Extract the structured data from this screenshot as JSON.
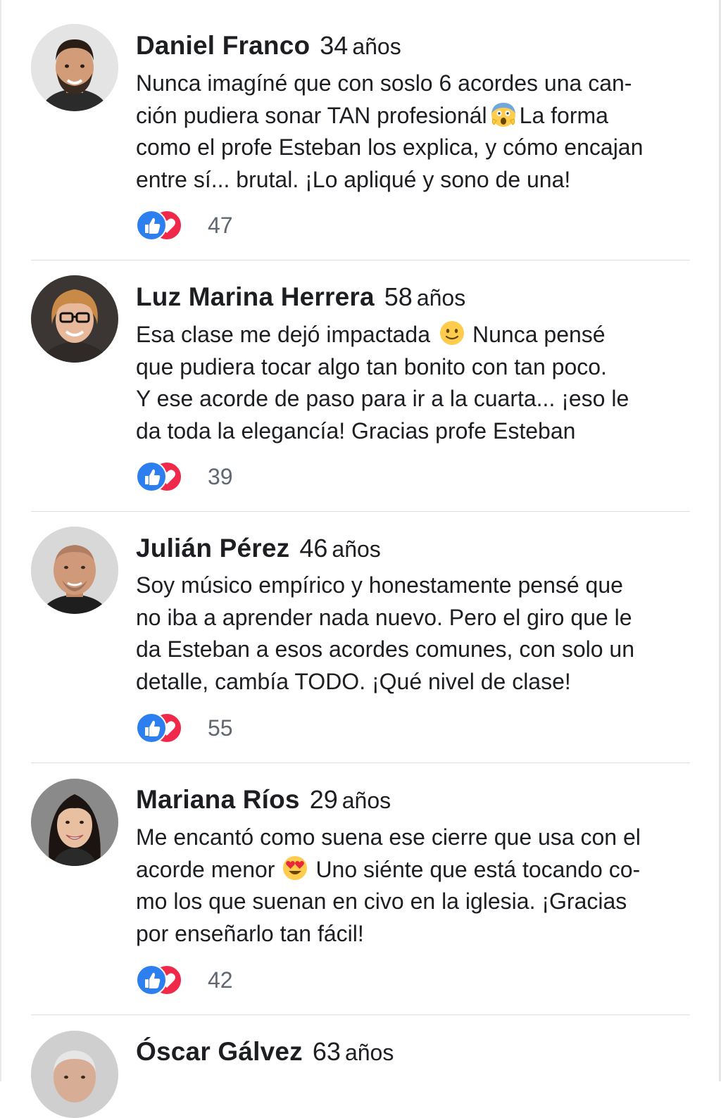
{
  "comments": [
    {
      "name": "Daniel Franco",
      "age": "34",
      "age_unit": "años",
      "lines": [
        "Nunca imagíné que con soslo 6 acordes una can-",
        "ción pudiera sonar TAN profesionál",
        "La forma",
        "como el profe Esteban los explica, y cómo encajan",
        "entre sí... brutal. ¡Lo apliqué y sono de una!"
      ],
      "emoji": "scream-emoji",
      "reactions": "47"
    },
    {
      "name": "Luz Marina Herrera",
      "age": "58",
      "age_unit": "años",
      "lines": [
        "Esa clase me dejó impactada",
        "Nunca pensé",
        "que pudiera tocar algo tan bonito con tan poco.",
        "Y ese acorde de paso para ir a la cuarta...  ¡eso le",
        "da toda la elegancía! Gracias profe Esteban"
      ],
      "emoji": "smile-emoji",
      "reactions": "39"
    },
    {
      "name": "Julián Pérez",
      "age": "46",
      "age_unit": "años",
      "lines": [
        "Soy músico empírico y honestamente pensé que",
        "no iba a aprender nada nuevo. Pero el giro que le",
        "da Esteban a esos acordes comunes, con solo un",
        "detalle, cambía TODO. ¡Qué nivel de clase!"
      ],
      "reactions": "55"
    },
    {
      "name": "Mariana Ríos",
      "age": "29",
      "age_unit": "años",
      "lines": [
        "Me encantó como suena ese cierre que usa con el",
        "acorde menor",
        "Uno siénte que está tocando co-",
        "mo los que suenan en civo en la iglesia. ¡Gracias",
        "por enseñarlo tan fácil!"
      ],
      "emoji": "heart-eyes-emoji",
      "reactions": "42"
    },
    {
      "name": "Óscar Gálvez",
      "age": "63",
      "age_unit": "años"
    }
  ]
}
